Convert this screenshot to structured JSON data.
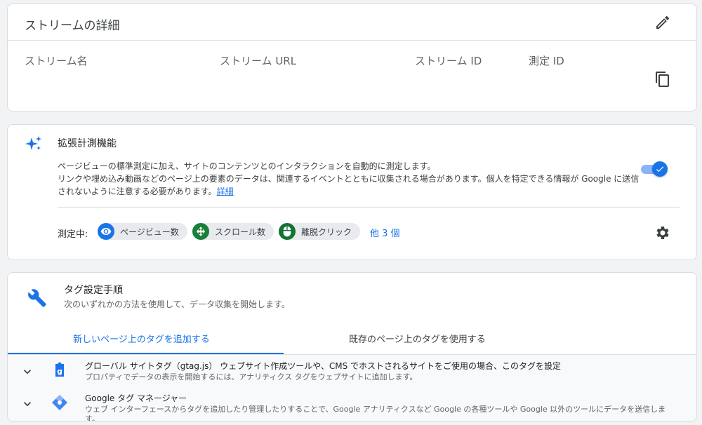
{
  "stream_details": {
    "title": "ストリームの詳細",
    "columns": [
      "ストリーム名",
      "ストリーム URL",
      "ストリーム ID",
      "測定 ID"
    ]
  },
  "enhanced_measurement": {
    "title": "拡張計測機能",
    "description_line1": "ページビューの標準測定に加え、サイトのコンテンツとのインタラクションを自動的に測定します。",
    "description_line2": "リンクや埋め込み動画などのページ上の要素のデータは、関連するイベントとともに収集される場合があります。個人を特定できる情報が Google に送信されないように注意する必要があります。",
    "details_link": "詳細",
    "toggle_on": true,
    "measuring_label": "測定中:",
    "chips": [
      "ページビュー数",
      "スクロール数",
      "離脱クリック"
    ],
    "more_link": "他 3 個"
  },
  "tag_setup": {
    "title": "タグ設定手順",
    "subtitle": "次のいずれかの方法を使用して、データ収集を開始します。",
    "tabs": [
      "新しいページ上のタグを追加する",
      "既存のページ上のタグを使用する"
    ],
    "items": [
      {
        "title": "グローバル サイトタグ（gtag.js） ウェブサイト作成ツールや、CMS でホストされるサイトをご使用の場合、このタグを設定",
        "description": "プロパティでデータの表示を開始するには、アナリティクス タグをウェブサイトに追加します。"
      },
      {
        "title": "Google タグ マネージャー",
        "description": "ウェブ インターフェースからタグを追加したり管理したりすることで、Google アナリティクスなど Google の各種ツールや Google 以外のツールにデータを送信します。"
      }
    ]
  },
  "colors": {
    "accent": "#1a73e8",
    "chip_pageview": "#1a73e8",
    "chip_scroll": "#188038",
    "chip_outbound": "#137333"
  }
}
